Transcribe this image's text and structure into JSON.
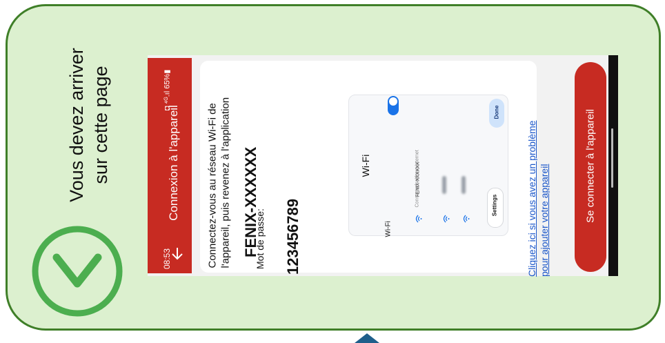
{
  "instruction": {
    "line1": "Vous devez arriver",
    "line2": "sur cette page"
  },
  "phone": {
    "status": {
      "time": "08:53",
      "icons": "◘ ⁴ᴳ.ıl 65%▮"
    },
    "appbar": {
      "title": "Connexion à l'appareil"
    },
    "content": {
      "line1": "Connectez-vous au réseau Wi-Fi de",
      "line2": "l'appareil, puis revenez à l'application",
      "ssid": "FENIX-XXXXXX",
      "password_label": "Mot de passe:",
      "password": "123456789"
    },
    "wifi_panel": {
      "title": "Wi-Fi",
      "row_label": "Wi-Fi",
      "network_name": "FENIX-XXXXXX",
      "network_status": "Connected without internet",
      "settings_label": "Settings",
      "done_label": "Done"
    },
    "help_link": {
      "line1": "Cliquez ici si vous avez un problème",
      "line2": "pour ajouter votre appareil"
    },
    "connect_button": "Se connecter à l'appareil"
  },
  "colors": {
    "brand_red": "#c72b22",
    "card_green": "#dcf0cf",
    "border_green": "#3f7f28",
    "check_green": "#4cae4f",
    "link_blue": "#1a56c9"
  }
}
